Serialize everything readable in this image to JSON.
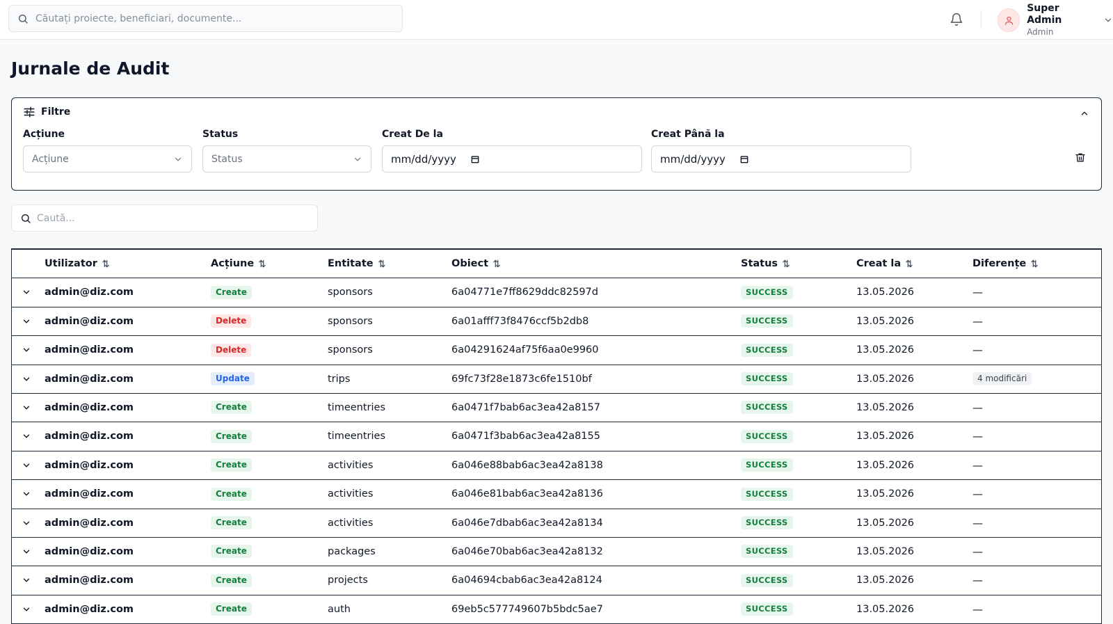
{
  "header": {
    "search_placeholder": "Căutați proiecte, beneficiari, documente...",
    "user_name": "Super Admin",
    "user_role": "Admin"
  },
  "page": {
    "title": "Jurnale de Audit"
  },
  "filters": {
    "title": "Filtre",
    "action_label": "Acțiune",
    "action_placeholder": "Acțiune",
    "status_label": "Status",
    "status_placeholder": "Status",
    "created_from_label": "Creat De la",
    "created_from_value": "mm/dd/yyyy",
    "created_to_label": "Creat Până la",
    "created_to_value": "mm/dd/yyyy"
  },
  "table_search": {
    "placeholder": "Caută..."
  },
  "table": {
    "columns": [
      "Utilizator",
      "Acțiune",
      "Entitate",
      "Obiect",
      "Status",
      "Creat la",
      "Diferențe"
    ],
    "rows": [
      {
        "user": "admin@diz.com",
        "action": "Create",
        "entity": "sponsors",
        "object": "6a04771e7ff8629ddc82597d",
        "status": "SUCCESS",
        "created": "13.05.2026",
        "diff": "—"
      },
      {
        "user": "admin@diz.com",
        "action": "Delete",
        "entity": "sponsors",
        "object": "6a01afff73f8476ccf5b2db8",
        "status": "SUCCESS",
        "created": "13.05.2026",
        "diff": "—"
      },
      {
        "user": "admin@diz.com",
        "action": "Delete",
        "entity": "sponsors",
        "object": "6a04291624af75f6aa0e9960",
        "status": "SUCCESS",
        "created": "13.05.2026",
        "diff": "—"
      },
      {
        "user": "admin@diz.com",
        "action": "Update",
        "entity": "trips",
        "object": "69fc73f28e1873c6fe1510bf",
        "status": "SUCCESS",
        "created": "13.05.2026",
        "diff": "4 modificări"
      },
      {
        "user": "admin@diz.com",
        "action": "Create",
        "entity": "timeentries",
        "object": "6a0471f7bab6ac3ea42a8157",
        "status": "SUCCESS",
        "created": "13.05.2026",
        "diff": "—"
      },
      {
        "user": "admin@diz.com",
        "action": "Create",
        "entity": "timeentries",
        "object": "6a0471f3bab6ac3ea42a8155",
        "status": "SUCCESS",
        "created": "13.05.2026",
        "diff": "—"
      },
      {
        "user": "admin@diz.com",
        "action": "Create",
        "entity": "activities",
        "object": "6a046e88bab6ac3ea42a8138",
        "status": "SUCCESS",
        "created": "13.05.2026",
        "diff": "—"
      },
      {
        "user": "admin@diz.com",
        "action": "Create",
        "entity": "activities",
        "object": "6a046e81bab6ac3ea42a8136",
        "status": "SUCCESS",
        "created": "13.05.2026",
        "diff": "—"
      },
      {
        "user": "admin@diz.com",
        "action": "Create",
        "entity": "activities",
        "object": "6a046e7dbab6ac3ea42a8134",
        "status": "SUCCESS",
        "created": "13.05.2026",
        "diff": "—"
      },
      {
        "user": "admin@diz.com",
        "action": "Create",
        "entity": "packages",
        "object": "6a046e70bab6ac3ea42a8132",
        "status": "SUCCESS",
        "created": "13.05.2026",
        "diff": "—"
      },
      {
        "user": "admin@diz.com",
        "action": "Create",
        "entity": "projects",
        "object": "6a04694cbab6ac3ea42a8124",
        "status": "SUCCESS",
        "created": "13.05.2026",
        "diff": "—"
      },
      {
        "user": "admin@diz.com",
        "action": "Create",
        "entity": "auth",
        "object": "69eb5c577749607b5bdc5ae7",
        "status": "SUCCESS",
        "created": "13.05.2026",
        "diff": "—"
      }
    ]
  },
  "colors": {
    "create_bg": "#e6f6ec",
    "create_fg": "#15803d",
    "delete_bg": "#fde7e7",
    "delete_fg": "#dc2626",
    "update_bg": "#e3edfc",
    "update_fg": "#2563eb",
    "border_dark": "#1f2937"
  },
  "icons": [
    "search-icon",
    "bell-icon",
    "user-icon",
    "chevron-down-icon",
    "sliders-icon",
    "chevron-up-icon",
    "calendar-icon",
    "trash-icon",
    "sort-icon"
  ]
}
